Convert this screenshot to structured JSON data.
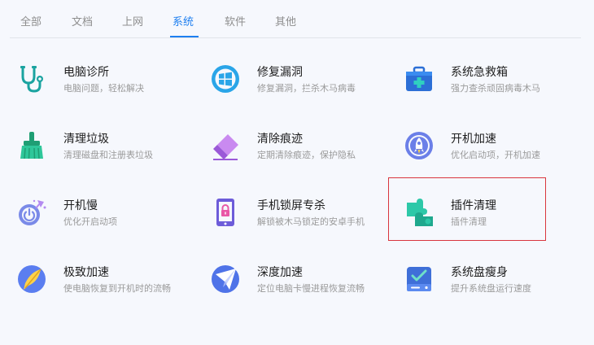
{
  "tabs": [
    {
      "label": "全部"
    },
    {
      "label": "文档"
    },
    {
      "label": "上网"
    },
    {
      "label": "系统"
    },
    {
      "label": "软件"
    },
    {
      "label": "其他"
    }
  ],
  "active_tab": "系统",
  "tools": [
    {
      "title": "电脑诊所",
      "desc": "电脑问题，轻松解决",
      "icon": "stethoscope-icon"
    },
    {
      "title": "修复漏洞",
      "desc": "修复漏洞，拦杀木马病毒",
      "icon": "windows-shield-icon"
    },
    {
      "title": "系统急救箱",
      "desc": "强力查杀顽固病毒木马",
      "icon": "first-aid-kit-icon"
    },
    {
      "title": "清理垃圾",
      "desc": "清理磁盘和注册表垃圾",
      "icon": "broom-icon"
    },
    {
      "title": "清除痕迹",
      "desc": "定期清除痕迹，保护隐私",
      "icon": "eraser-icon"
    },
    {
      "title": "开机加速",
      "desc": "优化启动项，开机加速",
      "icon": "rocket-icon"
    },
    {
      "title": "开机慢",
      "desc": "优化开启动项",
      "icon": "power-rocket-icon"
    },
    {
      "title": "手机锁屏专杀",
      "desc": "解锁被木马锁定的安卓手机",
      "icon": "phone-lock-icon"
    },
    {
      "title": "插件清理",
      "desc": "插件清理",
      "icon": "puzzle-icon"
    },
    {
      "title": "极致加速",
      "desc": "使电脑恢复到开机时的流畅",
      "icon": "feather-icon"
    },
    {
      "title": "深度加速",
      "desc": "定位电脑卡慢进程恢复流畅",
      "icon": "paper-plane-icon"
    },
    {
      "title": "系统盘瘦身",
      "desc": "提升系统盘运行速度",
      "icon": "disk-icon"
    }
  ],
  "colors": {
    "accent": "#1e7ff0",
    "highlight": "#d9363e",
    "background": "#f6f8fd"
  }
}
